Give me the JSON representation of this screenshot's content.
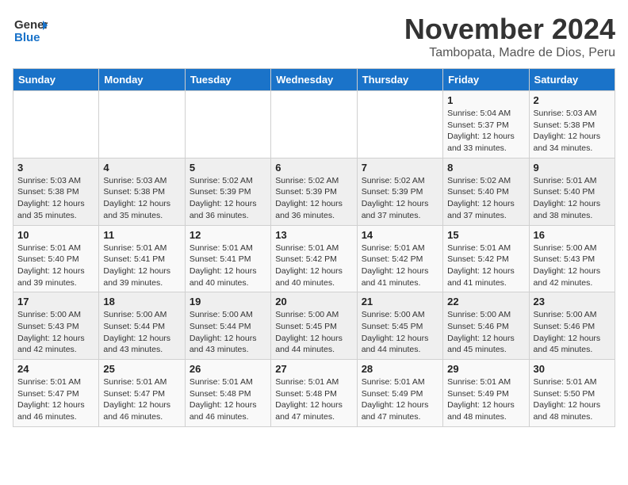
{
  "logo": {
    "general": "General",
    "blue": "Blue"
  },
  "title": "November 2024",
  "location": "Tambopata, Madre de Dios, Peru",
  "headers": [
    "Sunday",
    "Monday",
    "Tuesday",
    "Wednesday",
    "Thursday",
    "Friday",
    "Saturday"
  ],
  "weeks": [
    [
      {
        "day": "",
        "info": ""
      },
      {
        "day": "",
        "info": ""
      },
      {
        "day": "",
        "info": ""
      },
      {
        "day": "",
        "info": ""
      },
      {
        "day": "",
        "info": ""
      },
      {
        "day": "1",
        "info": "Sunrise: 5:04 AM\nSunset: 5:37 PM\nDaylight: 12 hours\nand 33 minutes."
      },
      {
        "day": "2",
        "info": "Sunrise: 5:03 AM\nSunset: 5:38 PM\nDaylight: 12 hours\nand 34 minutes."
      }
    ],
    [
      {
        "day": "3",
        "info": "Sunrise: 5:03 AM\nSunset: 5:38 PM\nDaylight: 12 hours\nand 35 minutes."
      },
      {
        "day": "4",
        "info": "Sunrise: 5:03 AM\nSunset: 5:38 PM\nDaylight: 12 hours\nand 35 minutes."
      },
      {
        "day": "5",
        "info": "Sunrise: 5:02 AM\nSunset: 5:39 PM\nDaylight: 12 hours\nand 36 minutes."
      },
      {
        "day": "6",
        "info": "Sunrise: 5:02 AM\nSunset: 5:39 PM\nDaylight: 12 hours\nand 36 minutes."
      },
      {
        "day": "7",
        "info": "Sunrise: 5:02 AM\nSunset: 5:39 PM\nDaylight: 12 hours\nand 37 minutes."
      },
      {
        "day": "8",
        "info": "Sunrise: 5:02 AM\nSunset: 5:40 PM\nDaylight: 12 hours\nand 37 minutes."
      },
      {
        "day": "9",
        "info": "Sunrise: 5:01 AM\nSunset: 5:40 PM\nDaylight: 12 hours\nand 38 minutes."
      }
    ],
    [
      {
        "day": "10",
        "info": "Sunrise: 5:01 AM\nSunset: 5:40 PM\nDaylight: 12 hours\nand 39 minutes."
      },
      {
        "day": "11",
        "info": "Sunrise: 5:01 AM\nSunset: 5:41 PM\nDaylight: 12 hours\nand 39 minutes."
      },
      {
        "day": "12",
        "info": "Sunrise: 5:01 AM\nSunset: 5:41 PM\nDaylight: 12 hours\nand 40 minutes."
      },
      {
        "day": "13",
        "info": "Sunrise: 5:01 AM\nSunset: 5:42 PM\nDaylight: 12 hours\nand 40 minutes."
      },
      {
        "day": "14",
        "info": "Sunrise: 5:01 AM\nSunset: 5:42 PM\nDaylight: 12 hours\nand 41 minutes."
      },
      {
        "day": "15",
        "info": "Sunrise: 5:01 AM\nSunset: 5:42 PM\nDaylight: 12 hours\nand 41 minutes."
      },
      {
        "day": "16",
        "info": "Sunrise: 5:00 AM\nSunset: 5:43 PM\nDaylight: 12 hours\nand 42 minutes."
      }
    ],
    [
      {
        "day": "17",
        "info": "Sunrise: 5:00 AM\nSunset: 5:43 PM\nDaylight: 12 hours\nand 42 minutes."
      },
      {
        "day": "18",
        "info": "Sunrise: 5:00 AM\nSunset: 5:44 PM\nDaylight: 12 hours\nand 43 minutes."
      },
      {
        "day": "19",
        "info": "Sunrise: 5:00 AM\nSunset: 5:44 PM\nDaylight: 12 hours\nand 43 minutes."
      },
      {
        "day": "20",
        "info": "Sunrise: 5:00 AM\nSunset: 5:45 PM\nDaylight: 12 hours\nand 44 minutes."
      },
      {
        "day": "21",
        "info": "Sunrise: 5:00 AM\nSunset: 5:45 PM\nDaylight: 12 hours\nand 44 minutes."
      },
      {
        "day": "22",
        "info": "Sunrise: 5:00 AM\nSunset: 5:46 PM\nDaylight: 12 hours\nand 45 minutes."
      },
      {
        "day": "23",
        "info": "Sunrise: 5:00 AM\nSunset: 5:46 PM\nDaylight: 12 hours\nand 45 minutes."
      }
    ],
    [
      {
        "day": "24",
        "info": "Sunrise: 5:01 AM\nSunset: 5:47 PM\nDaylight: 12 hours\nand 46 minutes."
      },
      {
        "day": "25",
        "info": "Sunrise: 5:01 AM\nSunset: 5:47 PM\nDaylight: 12 hours\nand 46 minutes."
      },
      {
        "day": "26",
        "info": "Sunrise: 5:01 AM\nSunset: 5:48 PM\nDaylight: 12 hours\nand 46 minutes."
      },
      {
        "day": "27",
        "info": "Sunrise: 5:01 AM\nSunset: 5:48 PM\nDaylight: 12 hours\nand 47 minutes."
      },
      {
        "day": "28",
        "info": "Sunrise: 5:01 AM\nSunset: 5:49 PM\nDaylight: 12 hours\nand 47 minutes."
      },
      {
        "day": "29",
        "info": "Sunrise: 5:01 AM\nSunset: 5:49 PM\nDaylight: 12 hours\nand 48 minutes."
      },
      {
        "day": "30",
        "info": "Sunrise: 5:01 AM\nSunset: 5:50 PM\nDaylight: 12 hours\nand 48 minutes."
      }
    ]
  ]
}
